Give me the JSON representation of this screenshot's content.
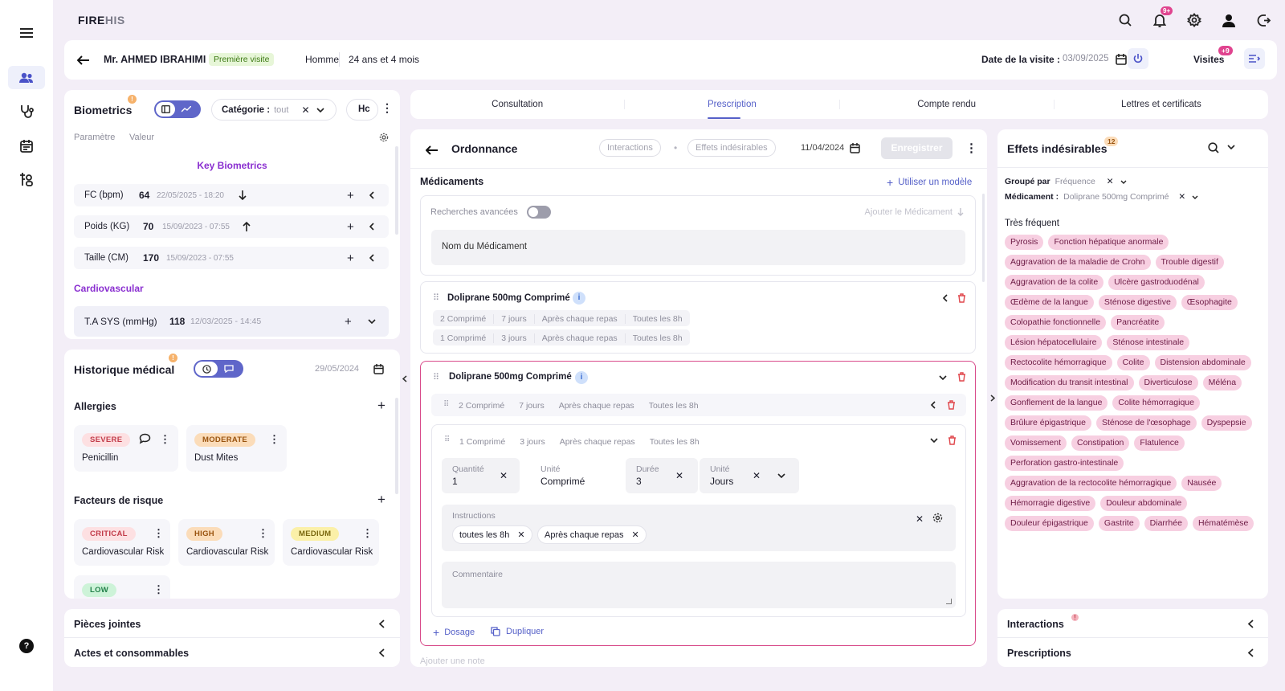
{
  "app": {
    "logo_a": "FIRE",
    "logo_b": "HIS",
    "notif_badge": "9+"
  },
  "patient": {
    "name": "Mr. AHMED IBRAHIMI",
    "visit_badge": "Première visite",
    "gender": "Homme",
    "age": "24 ans et 4 mois",
    "visit_date_label": "Date de la visite :",
    "visit_date": "03/09/2025",
    "visits_label": "Visites",
    "visits_badge": "+9"
  },
  "biometrics": {
    "title": "Biometrics",
    "category_label": "Catégorie :",
    "category_value": "tout",
    "tab_cut": "Hc",
    "col_param": "Paramètre",
    "col_value": "Valeur",
    "key_title": "Key Biometrics",
    "rows": [
      {
        "label": "FC (bpm)",
        "value": "64",
        "date": "22/05/2025 - 18:20"
      },
      {
        "label": "Poids (KG)",
        "value": "70",
        "date": "15/09/2023 - 07:55"
      },
      {
        "label": "Taille (CM)",
        "value": "170",
        "date": "15/09/2023 - 07:55"
      }
    ],
    "cardio_title": "Cardiovascular",
    "cardio_row": {
      "label": "T.A SYS (mmHg)",
      "value": "118",
      "date": "12/03/2025 - 14:45"
    }
  },
  "history": {
    "title": "Historique médical",
    "date": "29/05/2024",
    "allergies_title": "Allergies",
    "allergies": [
      {
        "severity": "SEVERE",
        "name": "Penicillin"
      },
      {
        "severity": "MODERATE",
        "name": "Dust Mites"
      }
    ],
    "risk_title": "Facteurs de risque",
    "risks": [
      {
        "level": "CRITICAL",
        "name": "Cardiovascular Risk"
      },
      {
        "level": "HIGH",
        "name": "Cardiovascular Risk"
      },
      {
        "level": "MEDIUM",
        "name": "Cardiovascular Risk"
      },
      {
        "level": "LOW",
        "name": ""
      }
    ]
  },
  "left_bottom": {
    "attachments": "Pièces jointes",
    "acts": "Actes et consommables"
  },
  "tabs": [
    "Consultation",
    "Prescription",
    "Compte rendu",
    "Lettres et certificats"
  ],
  "ordonnance": {
    "title": "Ordonnance",
    "interactions_btn": "Interactions",
    "effects_btn": "Effets indésirables",
    "date": "11/04/2024",
    "save_btn": "Enregistrer",
    "meds_title": "Médicaments",
    "use_model": "Utiliser un modèle",
    "advanced_search": "Recherches avancées",
    "add_med": "Ajouter le Médicament",
    "med_name_placeholder": "Nom du Médicament",
    "med1": {
      "name": "Doliprane 500mg Comprimé",
      "doses": [
        [
          "2 Comprimé",
          "7 jours",
          "Après chaque repas",
          "Toutes les 8h"
        ],
        [
          "1 Comprimé",
          "3 jours",
          "Après chaque repas",
          "Toutes les 8h"
        ]
      ]
    },
    "med2": {
      "name": "Doliprane 500mg Comprimé",
      "dose1": [
        "2 Comprimé",
        "7 jours",
        "Après chaque repas",
        "Toutes les 8h"
      ],
      "dose2": [
        "1 Comprimé",
        "3 jours",
        "Après chaque repas",
        "Toutes les 8h"
      ],
      "qty_label": "Quantité",
      "qty": "1",
      "unit_label": "Unité",
      "unit": "Comprimé",
      "dur_label": "Durée",
      "dur": "3",
      "dur_unit_label": "Unité",
      "dur_unit": "Jours",
      "instructions_label": "Instructions",
      "instr_tags": [
        "toutes les 8h",
        "Après chaque repas"
      ],
      "comment_label": "Commentaire",
      "dosage_btn": "Dosage",
      "duplicate_btn": "Dupliquer"
    },
    "add_note": "Ajouter une note"
  },
  "effects": {
    "title": "Effets indésirables",
    "badge": "12",
    "group_label": "Groupé par",
    "group_value": "Fréquence",
    "med_label": "Médicament :",
    "med_value": "Doliprane 500mg Comprimé",
    "freq_title": "Très fréquent",
    "tags": [
      "Pyrosis",
      "Fonction hépatique anormale",
      "Aggravation de la maladie de Crohn",
      "Trouble digestif",
      "Aggravation de la colite",
      "Ulcère gastroduodénal",
      "Œdème de la langue",
      "Sténose digestive",
      "Œsophagite",
      "Colopathie fonctionnelle",
      "Pancréatite",
      "Lésion hépatocellulaire",
      "Sténose intestinale",
      "Rectocolite hémorragique",
      "Colite",
      "Distension abdominale",
      "Modification du transit intestinal",
      "Diverticulose",
      "Méléna",
      "Gonflement de la langue",
      "Colite hémorragique",
      "Brûlure épigastrique",
      "Sténose de l'œsophage",
      "Dyspepsie",
      "Vomissement",
      "Constipation",
      "Flatulence",
      "Perforation gastro-intestinale",
      "Aggravation de la rectocolite hémorragique",
      "Nausée",
      "Hémorragie digestive",
      "Douleur abdominale",
      "Douleur épigastrique",
      "Gastrite",
      "Diarrhée",
      "Hématémèse"
    ]
  },
  "right_bottom": {
    "interactions": "Interactions",
    "prescriptions": "Prescriptions"
  },
  "colors": {
    "accent": "#7b3fe4",
    "pink": "#f7cfe1",
    "danger": "#e0474c"
  }
}
